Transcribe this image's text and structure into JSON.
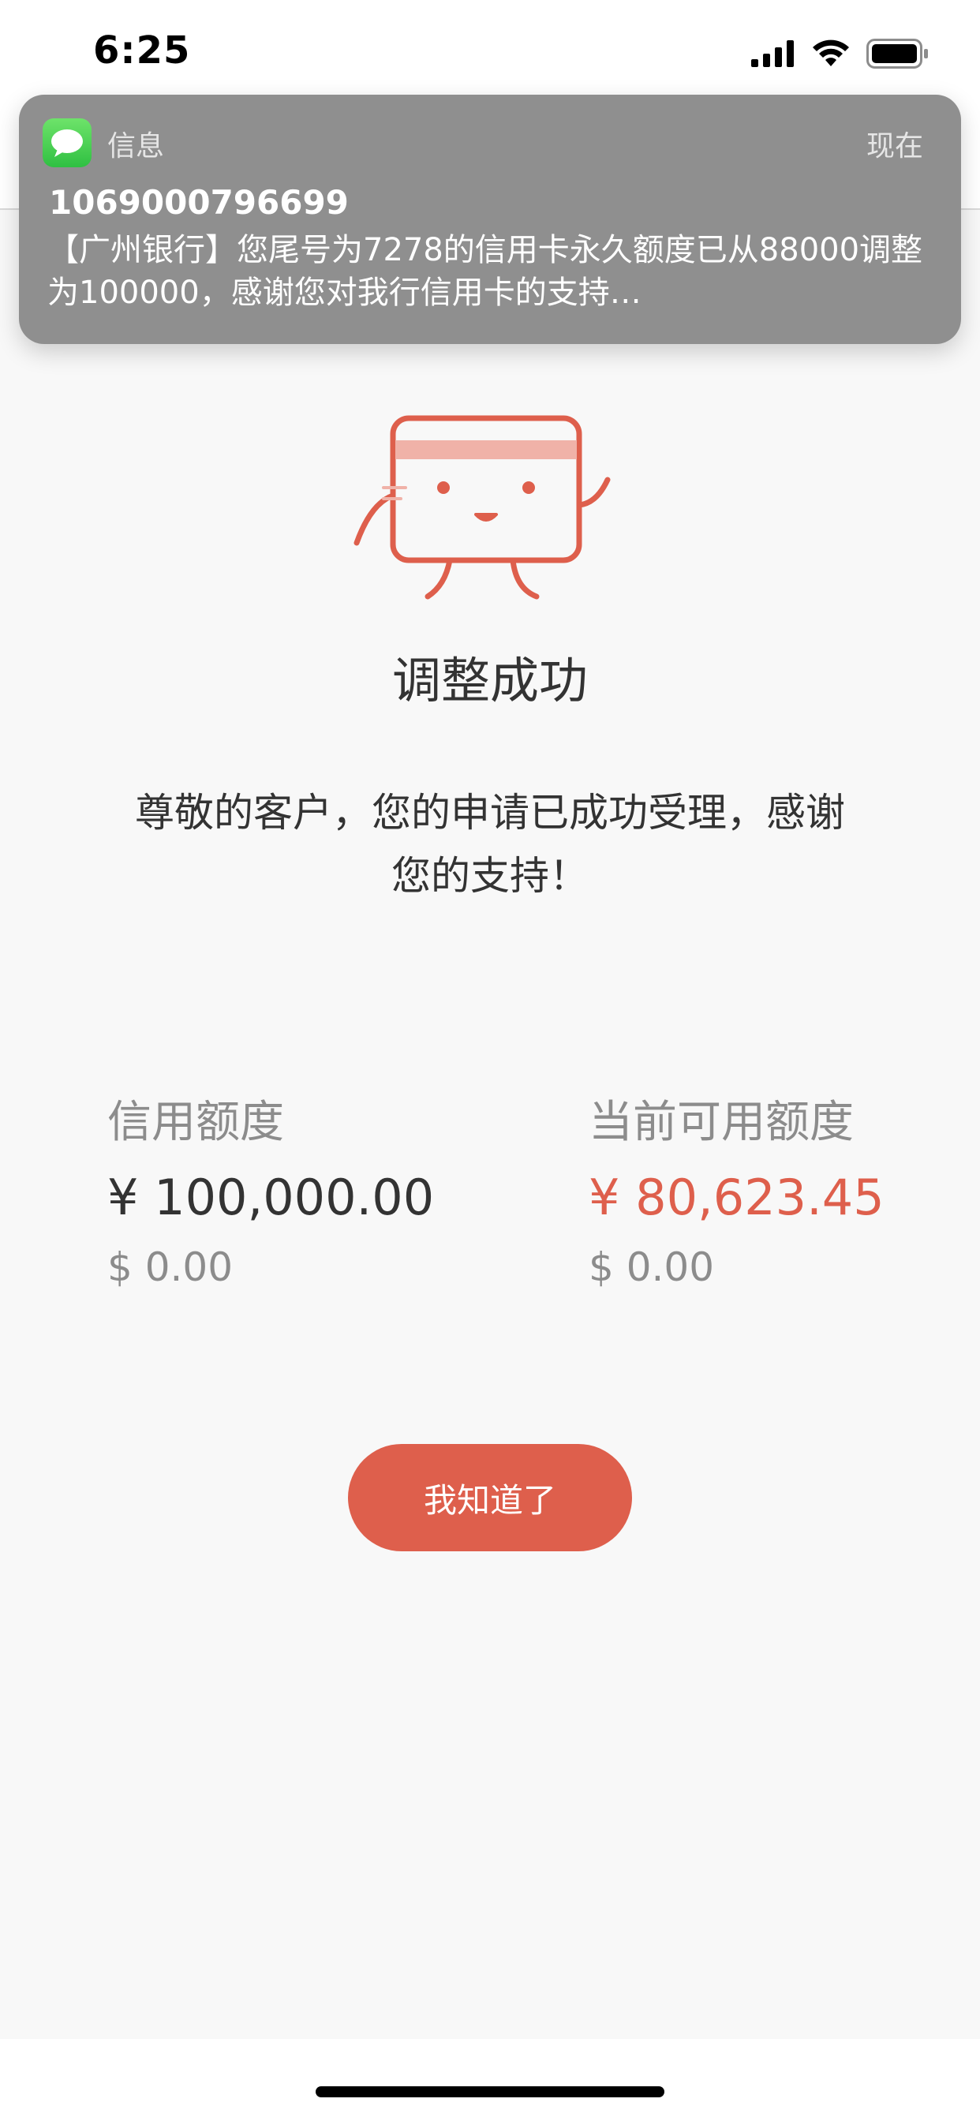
{
  "status_bar": {
    "time": "6:25"
  },
  "notification": {
    "app_name": "信息",
    "time": "现在",
    "sender": "1069000796699",
    "body": "【广州银行】您尾号为7278的信用卡永久额度已从88000调整为100000，感谢您对我行信用卡的支持…"
  },
  "result": {
    "title": "调整成功",
    "description": "尊敬的客户，您的申请已成功受理，感谢您的支持！"
  },
  "limits": {
    "credit": {
      "label": "信用额度",
      "cny": "¥ 100,000.00",
      "usd": "$ 0.00"
    },
    "available": {
      "label": "当前可用额度",
      "cny": "¥ 80,623.45",
      "usd": "$ 0.00"
    }
  },
  "actions": {
    "ok_label": "我知道了"
  },
  "colors": {
    "accent": "#de5f4c",
    "notification_bg": "#8f8f8f"
  },
  "icons": [
    "signal-icon",
    "wifi-icon",
    "battery-icon",
    "messages-app-icon",
    "card-mascot-icon"
  ]
}
